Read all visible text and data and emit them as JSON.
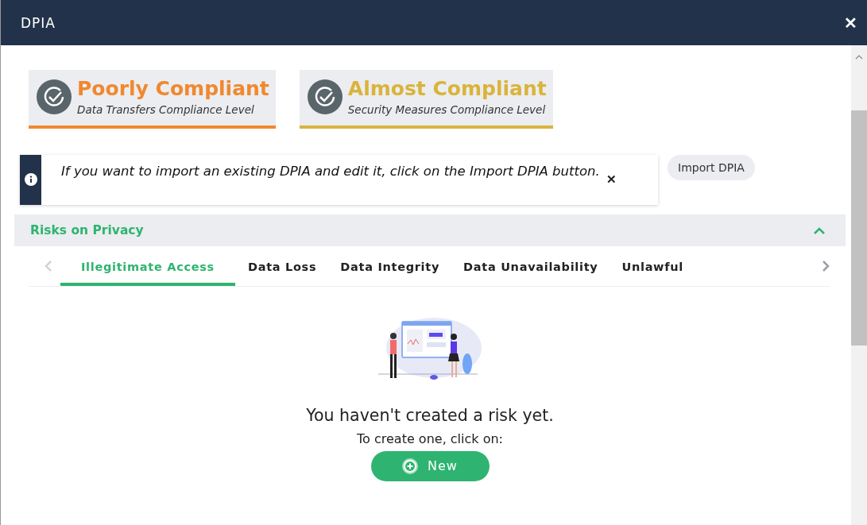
{
  "window": {
    "title": "DPIA",
    "close": "✕"
  },
  "compliance": [
    {
      "status": "Poorly Compliant",
      "caption": "Data Transfers Compliance Level",
      "color": "#f0882f"
    },
    {
      "status": "Almost Compliant",
      "caption": "Security Measures Compliance Level",
      "color": "#d9b43c"
    }
  ],
  "notice": {
    "text": "If you want to import an existing DPIA and edit it, click on the Import DPIA button.",
    "close": "✕"
  },
  "import_button": "Import DPIA",
  "section": {
    "title": "Risks on Privacy",
    "expanded": true
  },
  "tabs": [
    {
      "label": "Illegitimate Access",
      "selected": true
    },
    {
      "label": "Data Loss",
      "selected": false
    },
    {
      "label": "Data Integrity",
      "selected": false
    },
    {
      "label": "Data Unavailability",
      "selected": false
    },
    {
      "label": "Unlawful",
      "selected": false
    }
  ],
  "empty": {
    "title": "You haven't created a risk yet.",
    "hint": "To create one, click on:",
    "button": "New"
  }
}
